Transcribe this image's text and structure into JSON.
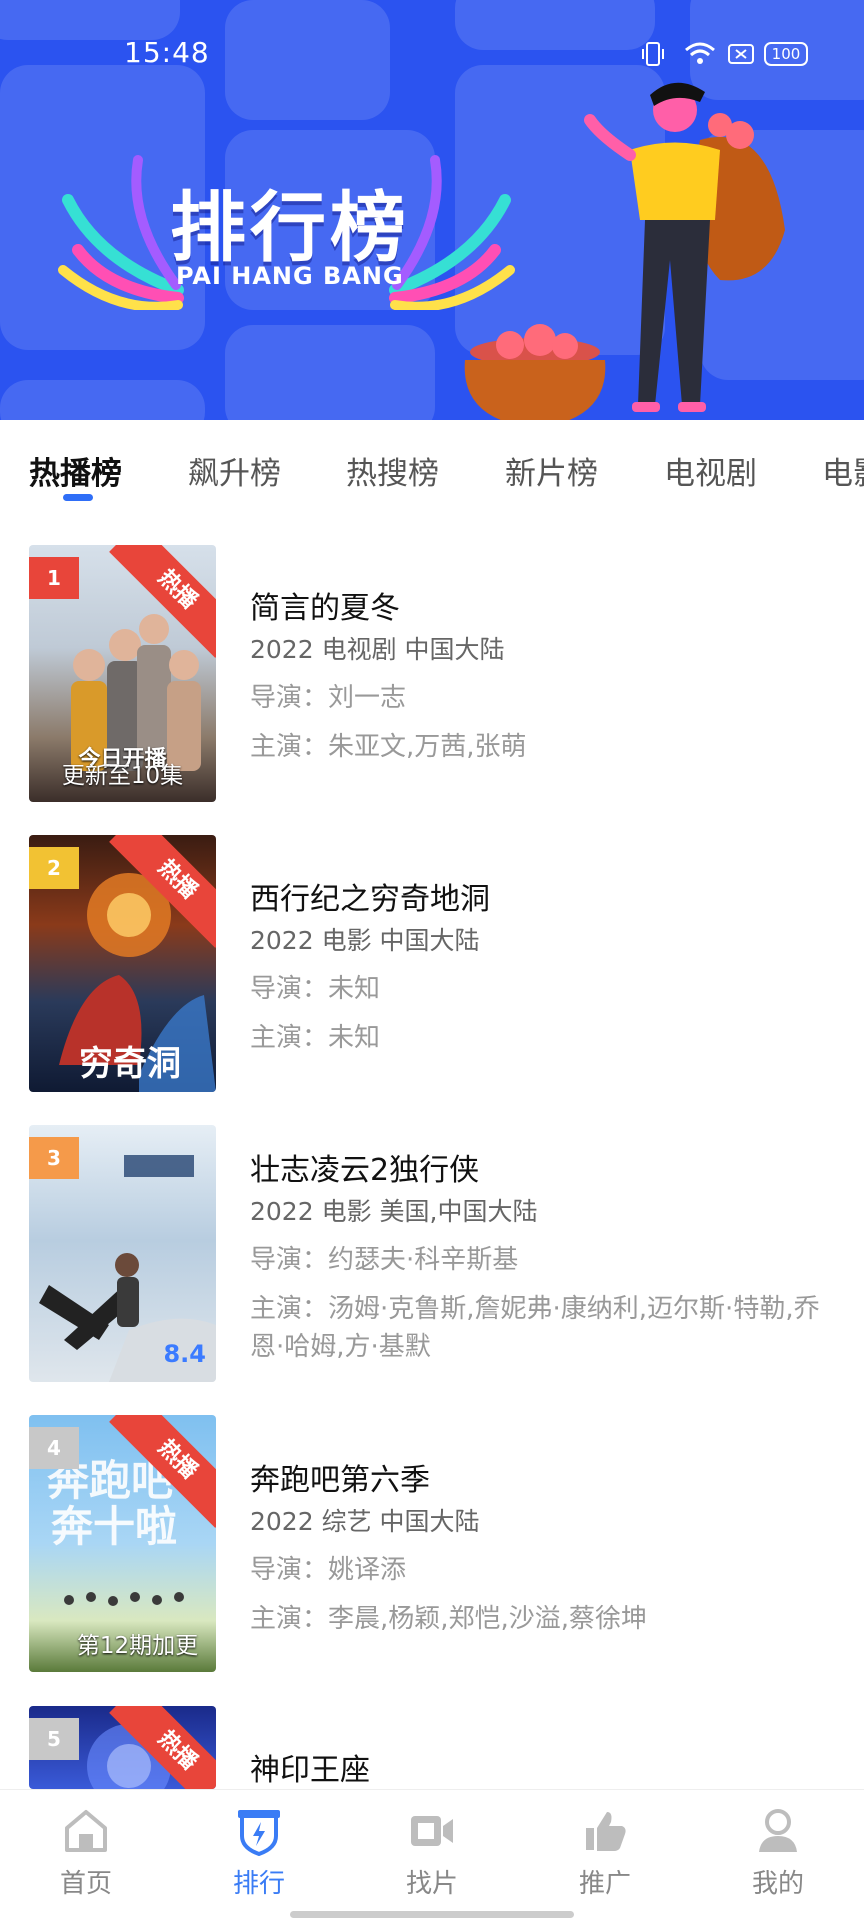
{
  "status_bar": {
    "time": "15:48",
    "battery": "100"
  },
  "banner": {
    "title_zh": "排行榜",
    "title_en": "PAI HANG BANG"
  },
  "tabs": [
    {
      "label": "热播榜",
      "active": true
    },
    {
      "label": "飙升榜",
      "active": false
    },
    {
      "label": "热搜榜",
      "active": false
    },
    {
      "label": "新片榜",
      "active": false
    },
    {
      "label": "电视剧",
      "active": false
    },
    {
      "label": "电影",
      "active": false
    }
  ],
  "movies": [
    {
      "rank": "1",
      "rank_color": "#e8453a",
      "hot": "热播",
      "title": "简言的夏冬",
      "info": "2022  电视剧  中国大陆",
      "director": "导演：刘一志",
      "cast": "主演：朱亚文,万茜,张萌",
      "poster_note": "更新至10集",
      "poster_text": "今日开播"
    },
    {
      "rank": "2",
      "rank_color": "#f2c233",
      "hot": "热播",
      "title": "西行纪之穷奇地洞",
      "info": "2022  电影  中国大陆",
      "director": "导演：未知",
      "cast": "主演：未知"
    },
    {
      "rank": "3",
      "rank_color": "#f59a4a",
      "title": "壮志凌云2独行侠",
      "info": "2022  电影  美国,中国大陆",
      "director": "导演：约瑟夫·科辛斯基",
      "cast": "主演：汤姆·克鲁斯,詹妮弗·康纳利,迈尔斯·特勒,乔恩·哈姆,方·基默",
      "score": "8.4"
    },
    {
      "rank": "4",
      "rank_color": "#c8c8c8",
      "hot": "热播",
      "title": "奔跑吧第六季",
      "info": "2022  综艺  中国大陆",
      "director": "导演：姚译添",
      "cast": "主演：李晨,杨颖,郑恺,沙溢,蔡徐坤",
      "poster_note": "第12期加更"
    },
    {
      "rank": "5",
      "rank_color": "#c8c8c8",
      "hot": "热播",
      "title": "神印王座"
    }
  ],
  "nav": [
    {
      "label": "首页",
      "icon": "home-icon",
      "active": false
    },
    {
      "label": "排行",
      "icon": "ranking-shield-icon",
      "active": true
    },
    {
      "label": "找片",
      "icon": "video-camera-icon",
      "active": false
    },
    {
      "label": "推广",
      "icon": "thumbs-up-icon",
      "active": false
    },
    {
      "label": "我的",
      "icon": "user-icon",
      "active": false
    }
  ],
  "colors": {
    "accent": "#3a7cf5",
    "banner": "#2b53f0",
    "hot_ribbon": "#e8453a"
  }
}
